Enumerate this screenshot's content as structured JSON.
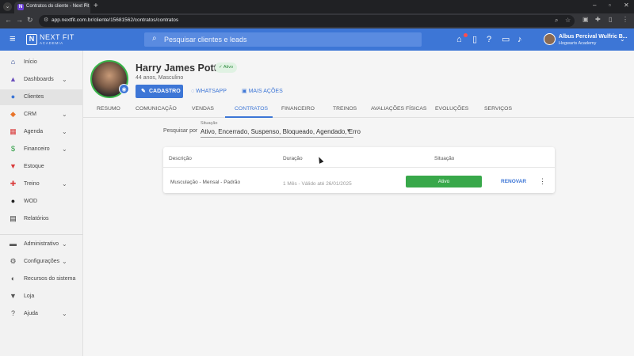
{
  "browser": {
    "tab_title": "Contratos do cliente - Next Fit",
    "tab_favicon": "N",
    "url": "app.nextfit.com.br/cliente/15681562/contratos/contratos",
    "new_tab_glyph": "+",
    "close_glyph": "×"
  },
  "header": {
    "logo_mark": "N",
    "logo_text": "NEXT FIT",
    "logo_sub": "ACADEMIA",
    "search_placeholder": "Pesquisar clientes e leads",
    "user_name": "Albus Percival Wulfric B...",
    "user_org": "Hogwarts Academy",
    "accent_color": "#3d76d6"
  },
  "sidebar": {
    "items": [
      {
        "label": "Início",
        "icon": "home-icon",
        "color": "#1e3a8a"
      },
      {
        "label": "Dashboards",
        "icon": "chart-icon",
        "color": "#6b4fbb"
      },
      {
        "label": "Clientes",
        "icon": "people-icon",
        "color": "#3d76d6"
      },
      {
        "label": "CRM",
        "icon": "crm-icon",
        "color": "#e8742a"
      },
      {
        "label": "Agenda",
        "icon": "calendar-icon",
        "color": "#d93a3a"
      },
      {
        "label": "Financeiro",
        "icon": "money-icon",
        "color": "#2e9e44"
      },
      {
        "label": "Estoque",
        "icon": "cart-icon",
        "color": "#d93a3a"
      },
      {
        "label": "Treino",
        "icon": "dumbbell-icon",
        "color": "#d93a3a"
      },
      {
        "label": "WOD",
        "icon": "kettlebell-icon",
        "color": "#222222"
      },
      {
        "label": "Relatórios",
        "icon": "report-icon",
        "color": "#333333"
      },
      {
        "label": "Administrativo",
        "icon": "admin-icon",
        "color": "#555555"
      },
      {
        "label": "Configurações",
        "icon": "gear-icon",
        "color": "#555555"
      },
      {
        "label": "Recursos do sistema",
        "icon": "toggle-icon",
        "color": "#555555"
      },
      {
        "label": "Loja",
        "icon": "shop-icon",
        "color": "#555555"
      },
      {
        "label": "Ajuda",
        "icon": "help-icon",
        "color": "#555555"
      }
    ]
  },
  "profile": {
    "name": "Harry James Potter",
    "status": "Ativo",
    "subtitle": "44 anos, Masculino",
    "btn_cadastro": "CADASTRO",
    "btn_whatsapp": "WHATSAPP",
    "btn_mais": "MAIS AÇÕES"
  },
  "tabs": [
    "RESUMO",
    "COMUNICAÇÃO",
    "VENDAS",
    "CONTRATOS",
    "FINANCEIRO",
    "TREINOS",
    "AVALIAÇÕES FÍSICAS",
    "EVOLUÇÕES",
    "SERVIÇOS"
  ],
  "active_tab": "CONTRATOS",
  "filter": {
    "label": "Pesquisar por",
    "caption": "Situação",
    "value": "Ativo, Encerrado, Suspenso, Bloqueado, Agendado, Erro"
  },
  "table": {
    "headers": [
      "Descrição",
      "Duração",
      "Situação"
    ],
    "rows": [
      {
        "descricao": "Musculação - Mensal - Padrão",
        "duracao": "1 Mês - Válido até 26/01/2025",
        "situacao": "Ativo",
        "action": "RENOVAR"
      }
    ],
    "status_color": "#38a84a"
  }
}
